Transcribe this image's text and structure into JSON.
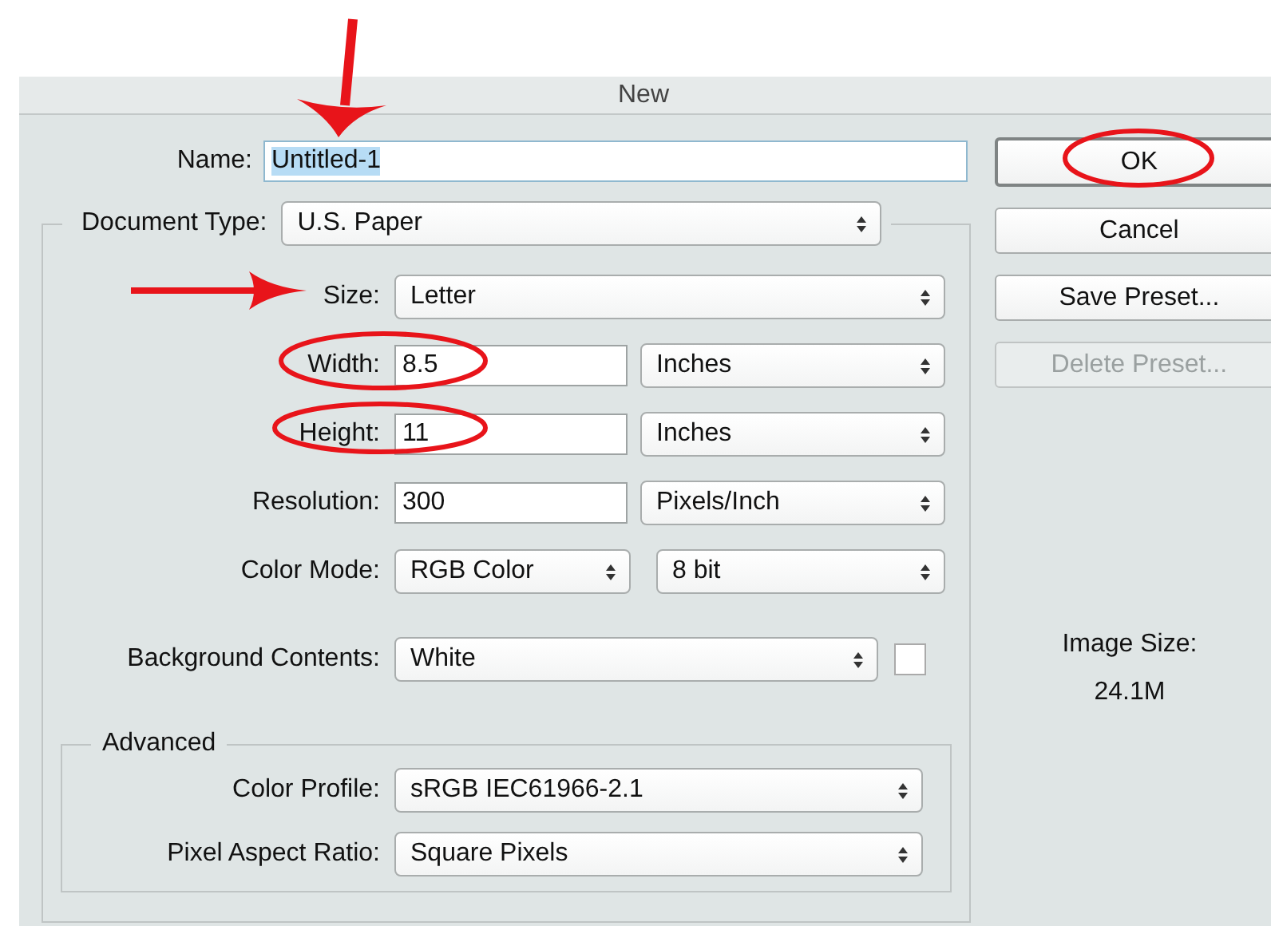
{
  "window": {
    "title": "New"
  },
  "name": {
    "label": "Name:",
    "value": "Untitled-1",
    "text_selected": true
  },
  "document_type": {
    "label": "Document Type:",
    "value": "U.S. Paper"
  },
  "rows": [
    {
      "kind": "select",
      "label": "Size:",
      "value": "Letter"
    },
    {
      "kind": "input_unit",
      "label": "Width:",
      "value": "8.5",
      "unit": "Inches"
    },
    {
      "kind": "input_unit",
      "label": "Height:",
      "value": "11",
      "unit": "Inches"
    },
    {
      "kind": "input_unit",
      "label": "Resolution:",
      "value": "300",
      "unit": "Pixels/Inch"
    },
    {
      "kind": "two_selects",
      "label": "Color Mode:",
      "value": "RGB Color",
      "unit": "8 bit"
    },
    {
      "kind": "select_swatch",
      "label": "Background Contents:",
      "value": "White"
    }
  ],
  "advanced": {
    "title": "Advanced",
    "rows": [
      {
        "label": "Color Profile:",
        "value": "sRGB IEC61966-2.1"
      },
      {
        "label": "Pixel Aspect Ratio:",
        "value": "Square Pixels"
      }
    ]
  },
  "buttons": [
    {
      "label": "OK",
      "default": true,
      "disabled": false
    },
    {
      "label": "Cancel",
      "default": false,
      "disabled": false
    },
    {
      "label": "Save Preset...",
      "default": false,
      "disabled": false
    },
    {
      "label": "Delete Preset...",
      "default": false,
      "disabled": true
    }
  ],
  "image_size": {
    "label": "Image Size:",
    "value": "24.1M"
  }
}
